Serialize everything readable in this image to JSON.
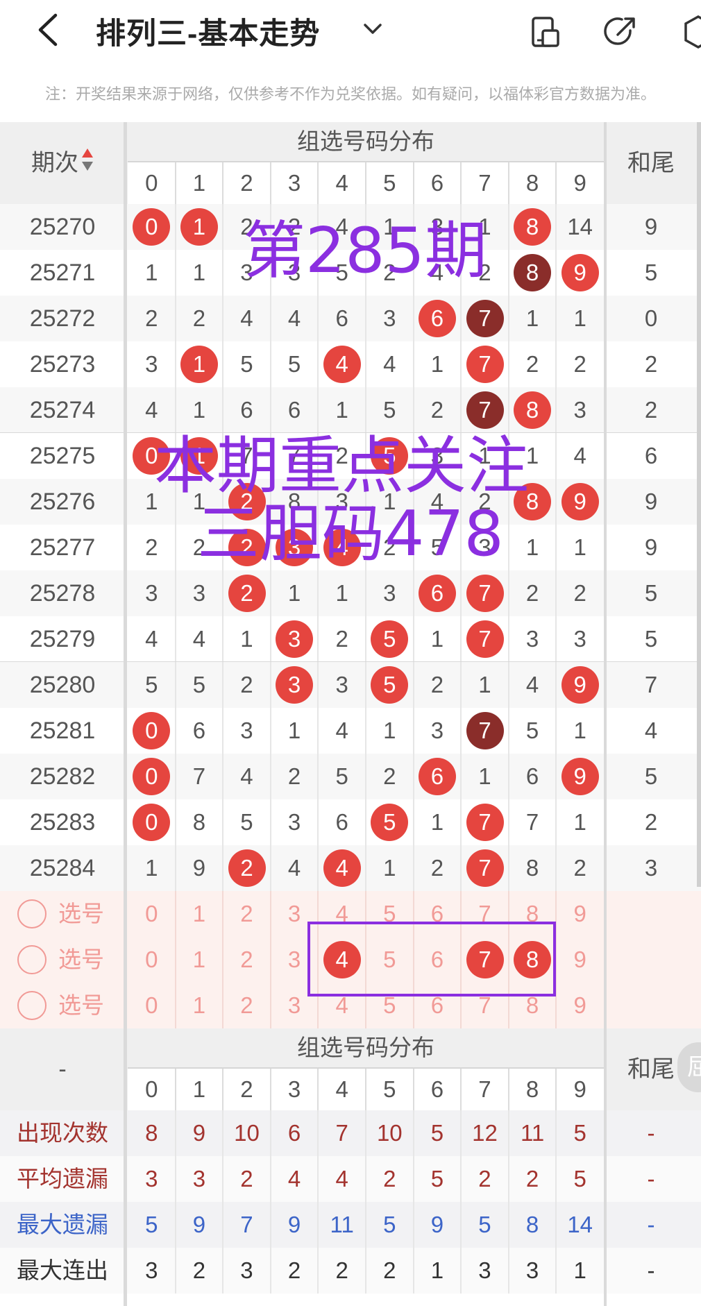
{
  "header": {
    "title": "排列三-基本走势",
    "notice": "注：开奖结果来源于网络，仅供参考不作为兑奖依据。如有疑问，以福体彩官方数据为准。"
  },
  "table": {
    "col_issue": "期次",
    "group_header": "组选号码分布",
    "col_tail": "和尾",
    "digits": [
      "0",
      "1",
      "2",
      "3",
      "4",
      "5",
      "6",
      "7",
      "8",
      "9"
    ],
    "rows": [
      {
        "issue": "25270",
        "cells": [
          "0",
          "1",
          "2",
          "2",
          "4",
          "1",
          "3",
          "1",
          "8",
          "14"
        ],
        "tail": "9",
        "hits": [
          {
            "d": 0,
            "c": "red"
          },
          {
            "d": 1,
            "c": "red"
          },
          {
            "d": 8,
            "c": "red"
          }
        ]
      },
      {
        "issue": "25271",
        "cells": [
          "1",
          "1",
          "3",
          "3",
          "5",
          "2",
          "4",
          "2",
          "8",
          "9"
        ],
        "tail": "5",
        "hits": [
          {
            "d": 8,
            "c": "dark"
          },
          {
            "d": 9,
            "c": "red"
          }
        ]
      },
      {
        "issue": "25272",
        "cells": [
          "2",
          "2",
          "4",
          "4",
          "6",
          "3",
          "6",
          "7",
          "1",
          "1"
        ],
        "tail": "0",
        "hits": [
          {
            "d": 6,
            "c": "red"
          },
          {
            "d": 7,
            "c": "dark"
          }
        ]
      },
      {
        "issue": "25273",
        "cells": [
          "3",
          "1",
          "5",
          "5",
          "4",
          "4",
          "1",
          "7",
          "2",
          "2"
        ],
        "tail": "2",
        "hits": [
          {
            "d": 1,
            "c": "red"
          },
          {
            "d": 4,
            "c": "red"
          },
          {
            "d": 7,
            "c": "red"
          }
        ]
      },
      {
        "issue": "25274",
        "cells": [
          "4",
          "1",
          "6",
          "6",
          "1",
          "5",
          "2",
          "7",
          "8",
          "3"
        ],
        "tail": "2",
        "hits": [
          {
            "d": 7,
            "c": "dark"
          },
          {
            "d": 8,
            "c": "red"
          }
        ]
      },
      {
        "issue": "25275",
        "cells": [
          "0",
          "1",
          "7",
          "7",
          "2",
          "5",
          "3",
          "1",
          "1",
          "4"
        ],
        "tail": "6",
        "hits": [
          {
            "d": 0,
            "c": "red"
          },
          {
            "d": 1,
            "c": "red"
          },
          {
            "d": 5,
            "c": "red"
          }
        ]
      },
      {
        "issue": "25276",
        "cells": [
          "1",
          "1",
          "2",
          "8",
          "3",
          "1",
          "4",
          "2",
          "8",
          "9"
        ],
        "tail": "9",
        "hits": [
          {
            "d": 2,
            "c": "red"
          },
          {
            "d": 8,
            "c": "red"
          },
          {
            "d": 9,
            "c": "red"
          }
        ]
      },
      {
        "issue": "25277",
        "cells": [
          "2",
          "2",
          "2",
          "3",
          "4",
          "2",
          "5",
          "3",
          "1",
          "1"
        ],
        "tail": "9",
        "hits": [
          {
            "d": 2,
            "c": "red"
          },
          {
            "d": 3,
            "c": "red"
          },
          {
            "d": 4,
            "c": "red"
          }
        ]
      },
      {
        "issue": "25278",
        "cells": [
          "3",
          "3",
          "2",
          "1",
          "1",
          "3",
          "6",
          "7",
          "2",
          "2"
        ],
        "tail": "5",
        "hits": [
          {
            "d": 2,
            "c": "red"
          },
          {
            "d": 6,
            "c": "red"
          },
          {
            "d": 7,
            "c": "red"
          }
        ]
      },
      {
        "issue": "25279",
        "cells": [
          "4",
          "4",
          "1",
          "3",
          "2",
          "5",
          "1",
          "7",
          "3",
          "3"
        ],
        "tail": "5",
        "hits": [
          {
            "d": 3,
            "c": "red"
          },
          {
            "d": 5,
            "c": "red"
          },
          {
            "d": 7,
            "c": "red"
          }
        ]
      },
      {
        "issue": "25280",
        "cells": [
          "5",
          "5",
          "2",
          "3",
          "3",
          "5",
          "2",
          "1",
          "4",
          "9"
        ],
        "tail": "7",
        "hits": [
          {
            "d": 3,
            "c": "red"
          },
          {
            "d": 5,
            "c": "red"
          },
          {
            "d": 9,
            "c": "red"
          }
        ]
      },
      {
        "issue": "25281",
        "cells": [
          "0",
          "6",
          "3",
          "1",
          "4",
          "1",
          "3",
          "7",
          "5",
          "1"
        ],
        "tail": "4",
        "hits": [
          {
            "d": 0,
            "c": "red"
          },
          {
            "d": 7,
            "c": "dark"
          }
        ]
      },
      {
        "issue": "25282",
        "cells": [
          "0",
          "7",
          "4",
          "2",
          "5",
          "2",
          "6",
          "1",
          "6",
          "9"
        ],
        "tail": "5",
        "hits": [
          {
            "d": 0,
            "c": "red"
          },
          {
            "d": 6,
            "c": "red"
          },
          {
            "d": 9,
            "c": "red"
          }
        ]
      },
      {
        "issue": "25283",
        "cells": [
          "0",
          "8",
          "5",
          "3",
          "6",
          "5",
          "1",
          "7",
          "7",
          "1"
        ],
        "tail": "2",
        "hits": [
          {
            "d": 0,
            "c": "red"
          },
          {
            "d": 5,
            "c": "red"
          },
          {
            "d": 7,
            "c": "red"
          }
        ]
      },
      {
        "issue": "25284",
        "cells": [
          "1",
          "9",
          "2",
          "4",
          "4",
          "1",
          "2",
          "7",
          "8",
          "2"
        ],
        "tail": "3",
        "hits": [
          {
            "d": 2,
            "c": "red"
          },
          {
            "d": 4,
            "c": "red"
          },
          {
            "d": 7,
            "c": "red"
          }
        ]
      }
    ]
  },
  "picker": {
    "label": "选号",
    "rows": [
      {
        "selected": []
      },
      {
        "selected": [
          4,
          7,
          8
        ]
      },
      {
        "selected": []
      }
    ]
  },
  "stats": {
    "left_header": "-",
    "group_header": "组选号码分布",
    "col_tail": "和尾",
    "tail_value": "-",
    "rows": [
      {
        "label": "出现次数",
        "color": "#a3332e",
        "values": [
          "8",
          "9",
          "10",
          "6",
          "7",
          "10",
          "5",
          "12",
          "11",
          "5"
        ]
      },
      {
        "label": "平均遗漏",
        "color": "#a3332e",
        "values": [
          "3",
          "3",
          "2",
          "4",
          "4",
          "2",
          "5",
          "2",
          "2",
          "5"
        ]
      },
      {
        "label": "最大遗漏",
        "color": "#3c64c8",
        "values": [
          "5",
          "9",
          "7",
          "9",
          "11",
          "5",
          "9",
          "5",
          "8",
          "14"
        ]
      },
      {
        "label": "最大连出",
        "color": "#333333",
        "values": [
          "3",
          "2",
          "3",
          "2",
          "2",
          "2",
          "1",
          "3",
          "3",
          "1"
        ]
      }
    ]
  },
  "overlay": {
    "line1": "第285期",
    "line2": "本期重点关注",
    "line3": "三胆码478",
    "color": "#8b2fe0"
  },
  "side_handle": "屈"
}
